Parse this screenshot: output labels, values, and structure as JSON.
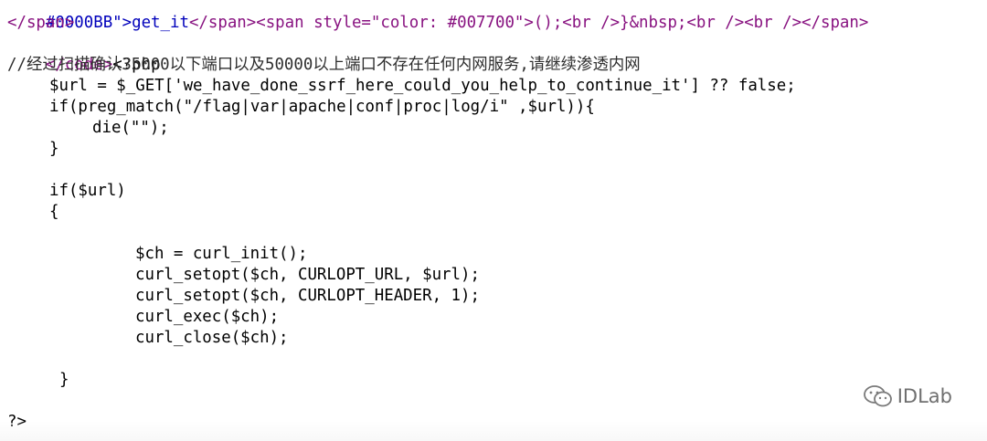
{
  "code_lines": {
    "l0_prefix": "#0000BB\">get_it",
    "l0_tags": "</span><span style=\"color: #007700\">();<br />}&nbsp;<br /><br /></span>",
    "l1": "</span>",
    "l2_code": "</code>",
    "l2_php": "<?php",
    "l3_comment": "//经过扫描确认35000以下端口以及50000以上端口不存在任何内网服务,请继续渗透内网",
    "l4": "$url = $_GET['we_have_done_ssrf_here_could_you_help_to_continue_it'] ?? false;",
    "l5": "if(preg_match(\"/flag|var|apache|conf|proc|log/i\" ,$url)){",
    "l6": "die(\"\");",
    "l7": "}",
    "l8": "",
    "l9": "if($url)",
    "l10": "{",
    "l11": "",
    "l12": "$ch = curl_init();",
    "l13": "curl_setopt($ch, CURLOPT_URL, $url);",
    "l14": "curl_setopt($ch, CURLOPT_HEADER, 1);",
    "l15": "curl_exec($ch);",
    "l16": "curl_close($ch);",
    "l17": "",
    "l18": "}",
    "l19": "",
    "l20": "?>"
  },
  "watermark": {
    "icon": "wechat-icon",
    "text": "IDLab"
  },
  "colors": {
    "tag_blue": "#0000bb",
    "tag_purple": "#881280",
    "text": "#000000"
  }
}
